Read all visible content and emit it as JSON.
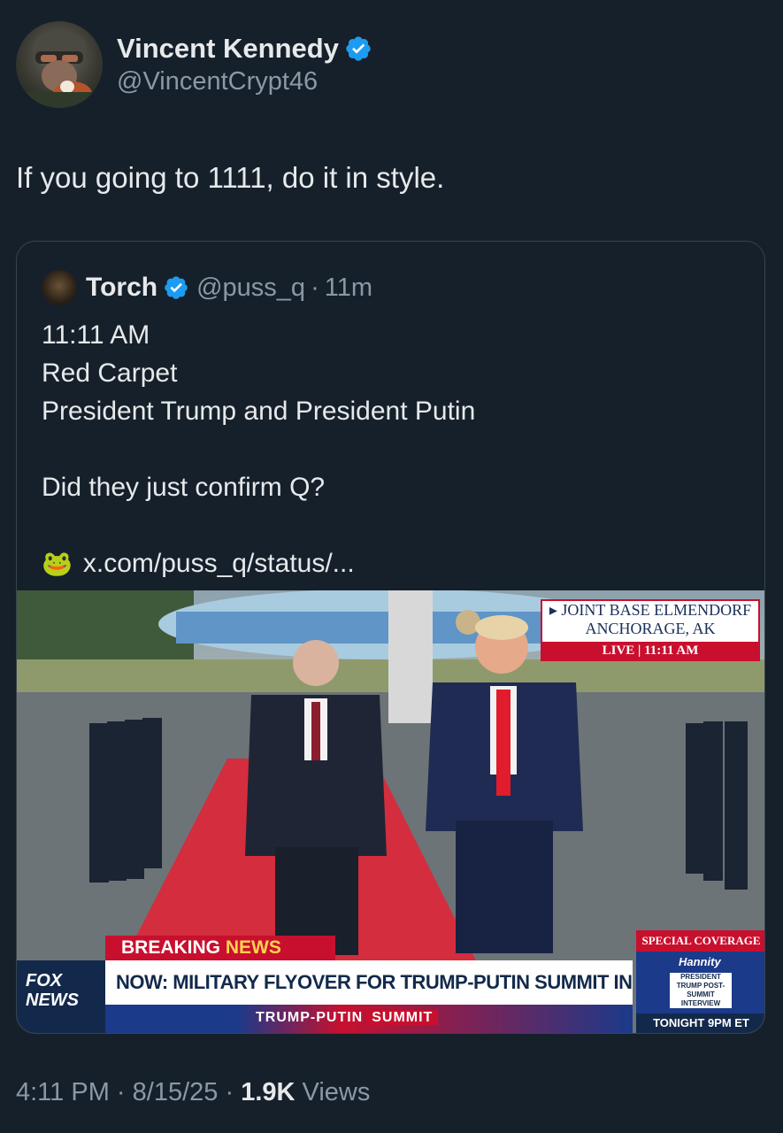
{
  "author": {
    "display_name": "Vincent Kennedy",
    "handle": "@VincentCrypt46",
    "avatar": "avatar-helmet-person-with-red-panda",
    "verified_icon": "verified-badge-icon"
  },
  "tweet": {
    "text": "If you going to 1111, do it in style."
  },
  "quoted": {
    "display_name": "Torch",
    "handle": "@puss_q",
    "separator": "·",
    "time_ago": "11m",
    "lines": [
      "11:11 AM",
      "Red Carpet",
      "President Trump and President Putin",
      "",
      "Did they just confirm Q?",
      ""
    ],
    "link_emoji": "🐸",
    "link_text": "x.com/puss_q/status/..."
  },
  "media": {
    "location_line1": "▸ JOINT BASE ELMENDORF",
    "location_line2": "ANCHORAGE, AK",
    "live_label": "LIVE",
    "live_time": "11:11 AM",
    "breaking_label": "BREAKING",
    "breaking_news": "NEWS",
    "headline": "NOW: MILITARY FLYOVER FOR TRUMP-PUTIN SUMMIT IN AK",
    "subbar_text": "TRUMP-PUTIN",
    "subbar_summit": "SUMMIT",
    "fox_line1": "FOX",
    "fox_line2": "NEWS",
    "special_coverage": "SPECIAL COVERAGE",
    "hannity": "Hannity",
    "hannity_sub": "PRESIDENT TRUMP POST-SUMMIT INTERVIEW",
    "tonight": "TONIGHT 9PM ET"
  },
  "footer": {
    "time": "4:11 PM",
    "date": "8/15/25",
    "separator": "·",
    "views_count": "1.9K",
    "views_label": "Views"
  },
  "colors": {
    "background": "#15202b",
    "text_primary": "#e7e9ea",
    "text_secondary": "#8b98a5",
    "verified_blue": "#1d9bf0",
    "border": "#38444d"
  }
}
